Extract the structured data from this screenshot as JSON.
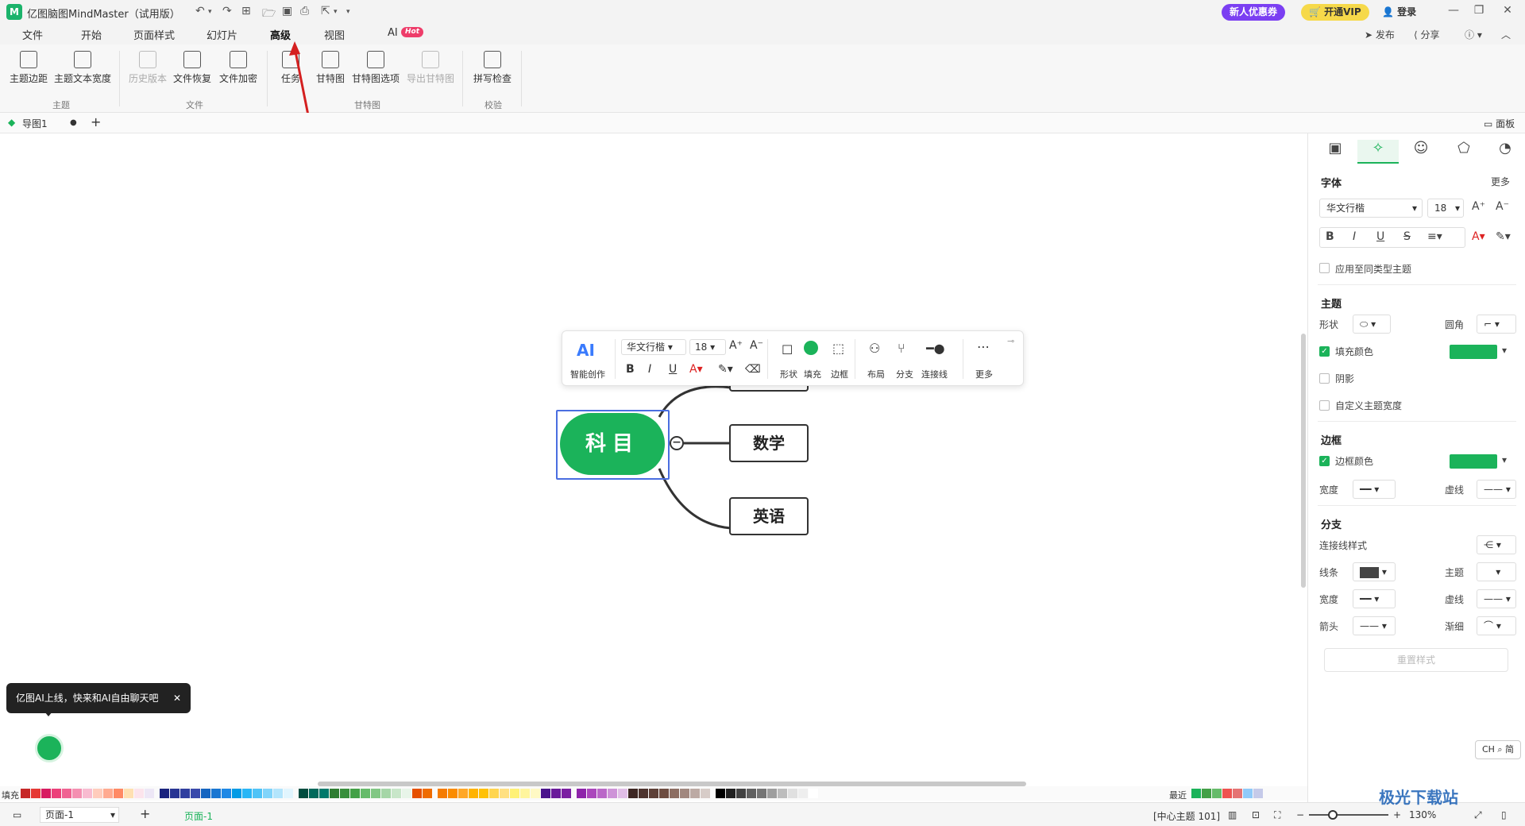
{
  "titlebar": {
    "app_title": "亿图脑图MindMaster（试用版）",
    "promo_new": "新人优惠券",
    "promo_vip": "开通VIP",
    "login": "登录"
  },
  "menu": {
    "tabs": [
      "文件",
      "开始",
      "页面样式",
      "幻灯片",
      "高级",
      "视图",
      "AI"
    ],
    "hot_badge": "Hot",
    "publish": "发布",
    "share": "分享"
  },
  "ribbon": {
    "buttons": [
      "主题边距",
      "主题文本宽度",
      "历史版本",
      "文件恢复",
      "文件加密",
      "任务",
      "甘特图",
      "甘特图选项",
      "导出甘特图",
      "拼写检查"
    ],
    "groups": [
      "主题",
      "文件",
      "甘特图",
      "校验"
    ],
    "panel_toggle": "面板"
  },
  "doctabs": {
    "active_tab": "导图1"
  },
  "mindmap": {
    "central": "科目",
    "branches": [
      "数学",
      "英语"
    ]
  },
  "floatbar": {
    "ai_label": "AI",
    "ai_caption": "智能创作",
    "font": "华文行楷",
    "size": "18",
    "labels": [
      "形状",
      "填充",
      "边框",
      "布局",
      "分支",
      "连接线",
      "更多"
    ]
  },
  "panel": {
    "font_section": "字体",
    "more": "更多",
    "font": "华文行楷",
    "size": "18",
    "apply_same": "应用至同类型主题",
    "topic_section": "主题",
    "shape": "形状",
    "corner": "圆角",
    "fill_color": "填充颜色",
    "shadow": "阴影",
    "custom_width": "自定义主题宽度",
    "border_section": "边框",
    "border_color": "边框颜色",
    "width": "宽度",
    "dash": "虚线",
    "branch_section": "分支",
    "connector_style": "连接线样式",
    "line": "线条",
    "topic": "主题",
    "arrow": "箭头",
    "taper": "渐细",
    "reset": "重置样式",
    "accent": "#1bb35a"
  },
  "palette": {
    "fill_label": "填充",
    "recent_label": "最近"
  },
  "statusbar": {
    "page_select": "页面-1",
    "page_tab": "页面-1",
    "center_info": "[中心主题 101]",
    "zoom": "130%"
  },
  "ai_tip": "亿图AI上线，快来和AI自由聊天吧",
  "ime": "CH ⌕ 简",
  "watermark": "极光下载站"
}
